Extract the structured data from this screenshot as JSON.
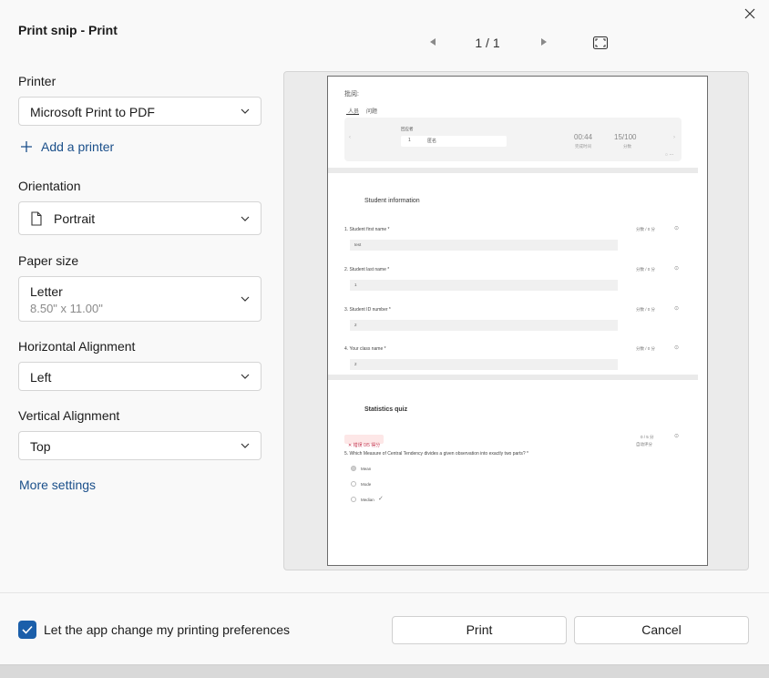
{
  "window": {
    "title": "Print snip - Print"
  },
  "pager": {
    "count": "1 / 1"
  },
  "printer": {
    "label": "Printer",
    "value": "Microsoft Print to PDF",
    "add_label": "Add a printer"
  },
  "orientation": {
    "label": "Orientation",
    "value": "Portrait"
  },
  "paper_size": {
    "label": "Paper size",
    "value": "Letter",
    "detail": "8.50\" x 11.00\""
  },
  "horizontal_alignment": {
    "label": "Horizontal Alignment",
    "value": "Left"
  },
  "vertical_alignment": {
    "label": "Vertical Alignment",
    "value": "Top"
  },
  "more_settings": "More settings",
  "footer": {
    "preferences_label": "Let the app change my printing preferences",
    "print_label": "Print",
    "cancel_label": "Cancel"
  },
  "preview": {
    "header": "批阅:",
    "tabs": [
      "人员",
      "问题"
    ],
    "responder_label": "回应者",
    "responder_num": "1",
    "responder_name": "匿名",
    "time": "00:44",
    "time_label": "完成时间",
    "score": "15/100",
    "score_label": "分数",
    "section1": "Student information",
    "questions": [
      {
        "label": "1. Student first name *",
        "value": "test",
        "meta": "分数 / 0 分"
      },
      {
        "label": "2. Student last name *",
        "value": "1",
        "meta": "分数 / 0 分"
      },
      {
        "label": "3. Student ID number *",
        "value": "2",
        "meta": "分数 / 0 分"
      },
      {
        "label": "4. Your class name *",
        "value": "2",
        "meta": "分数 / 0 分"
      }
    ],
    "section2": "Statistics quiz",
    "badge": "✕ 错误 0/5 得分",
    "quiz_meta": "0 / 5 分",
    "quiz_meta2": "自动评分",
    "quiz_question": "5. Which Measure of Central Tendency divides a given observation into exactly two parts? *",
    "options": [
      "Mean",
      "Mode",
      "Median"
    ]
  },
  "colors": {
    "accent": "#1b5faa",
    "link": "#1a4f8a"
  }
}
